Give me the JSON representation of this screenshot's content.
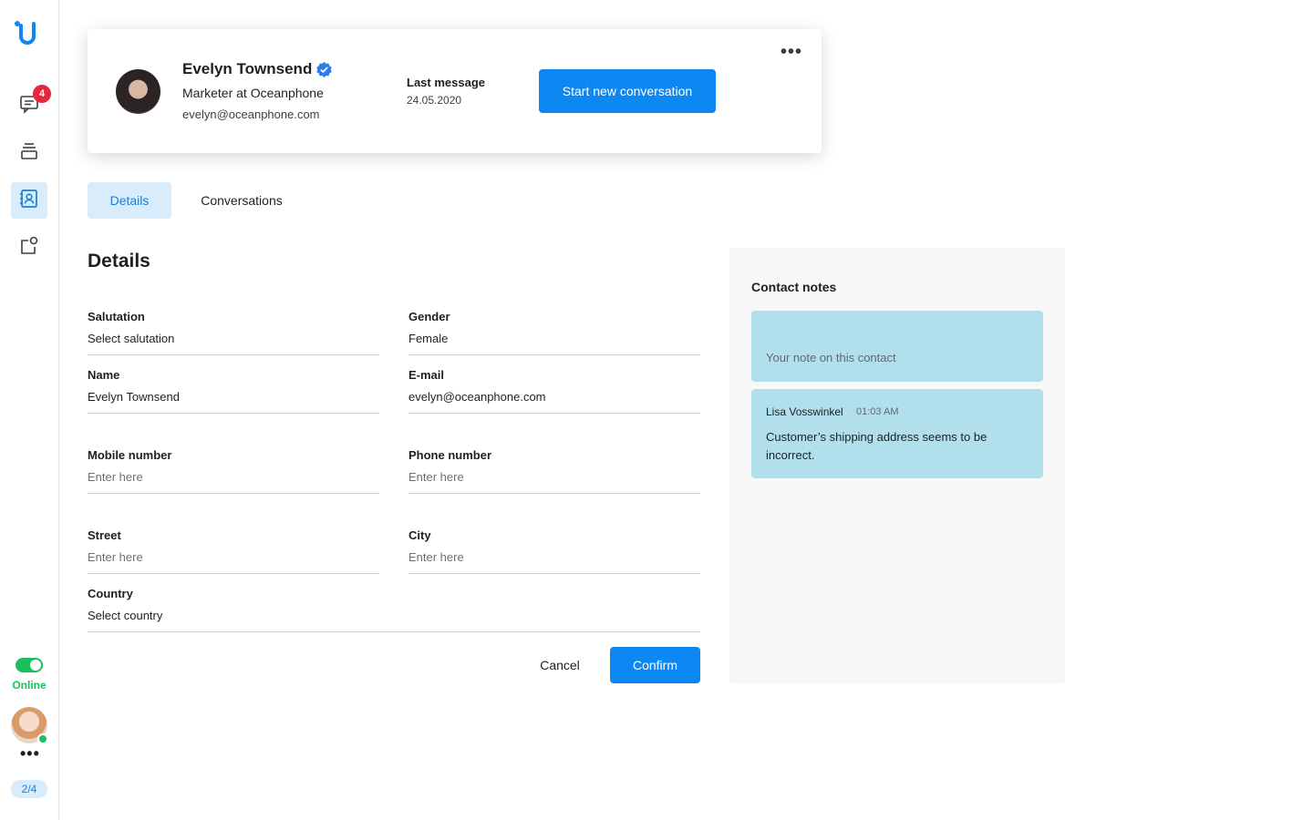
{
  "sidebar": {
    "logo_icon": "brand-logo-icon",
    "chat_badge": "4",
    "items": [
      {
        "icon": "chat-icon"
      },
      {
        "icon": "stack-icon"
      },
      {
        "icon": "contacts-icon"
      },
      {
        "icon": "apps-icon"
      }
    ],
    "status_label": "Online",
    "more_label": "•••",
    "page_indicator": "2/4"
  },
  "profile": {
    "name": "Evelyn Townsend",
    "role": "Marketer at Oceanphone",
    "email": "evelyn@oceanphone.com",
    "last_message_label": "Last message",
    "last_message_date": "24.05.2020",
    "start_button": "Start new conversation",
    "more_label": "•••"
  },
  "tabs": [
    {
      "label": "Details",
      "active": true
    },
    {
      "label": "Conversations",
      "active": false
    }
  ],
  "details": {
    "title": "Details",
    "fields": {
      "salutation": {
        "label": "Salutation",
        "value": "Select salutation"
      },
      "gender": {
        "label": "Gender",
        "value": "Female"
      },
      "name": {
        "label": "Name",
        "value": "Evelyn Townsend"
      },
      "email": {
        "label": "E-mail",
        "value": "evelyn@oceanphone.com"
      },
      "mobile": {
        "label": "Mobile number",
        "placeholder": "Enter here"
      },
      "phone": {
        "label": "Phone number",
        "placeholder": "Enter here"
      },
      "street": {
        "label": "Street",
        "placeholder": "Enter here"
      },
      "city": {
        "label": "City",
        "placeholder": "Enter here"
      },
      "country": {
        "label": "Country",
        "value": "Select country"
      }
    },
    "cancel_label": "Cancel",
    "confirm_label": "Confirm"
  },
  "notes": {
    "title": "Contact notes",
    "input_placeholder": "Your note on this contact",
    "items": [
      {
        "author": "Lisa Vosswinkel",
        "time": "01:03 AM",
        "text": "Customer’s shipping address seems to be incorrect."
      }
    ]
  },
  "colors": {
    "accent": "#0d88f2",
    "accent_light": "#d9ecfb",
    "online": "#1cbf5e",
    "badge": "#e5273f",
    "note_bg": "#b1e0ec"
  }
}
